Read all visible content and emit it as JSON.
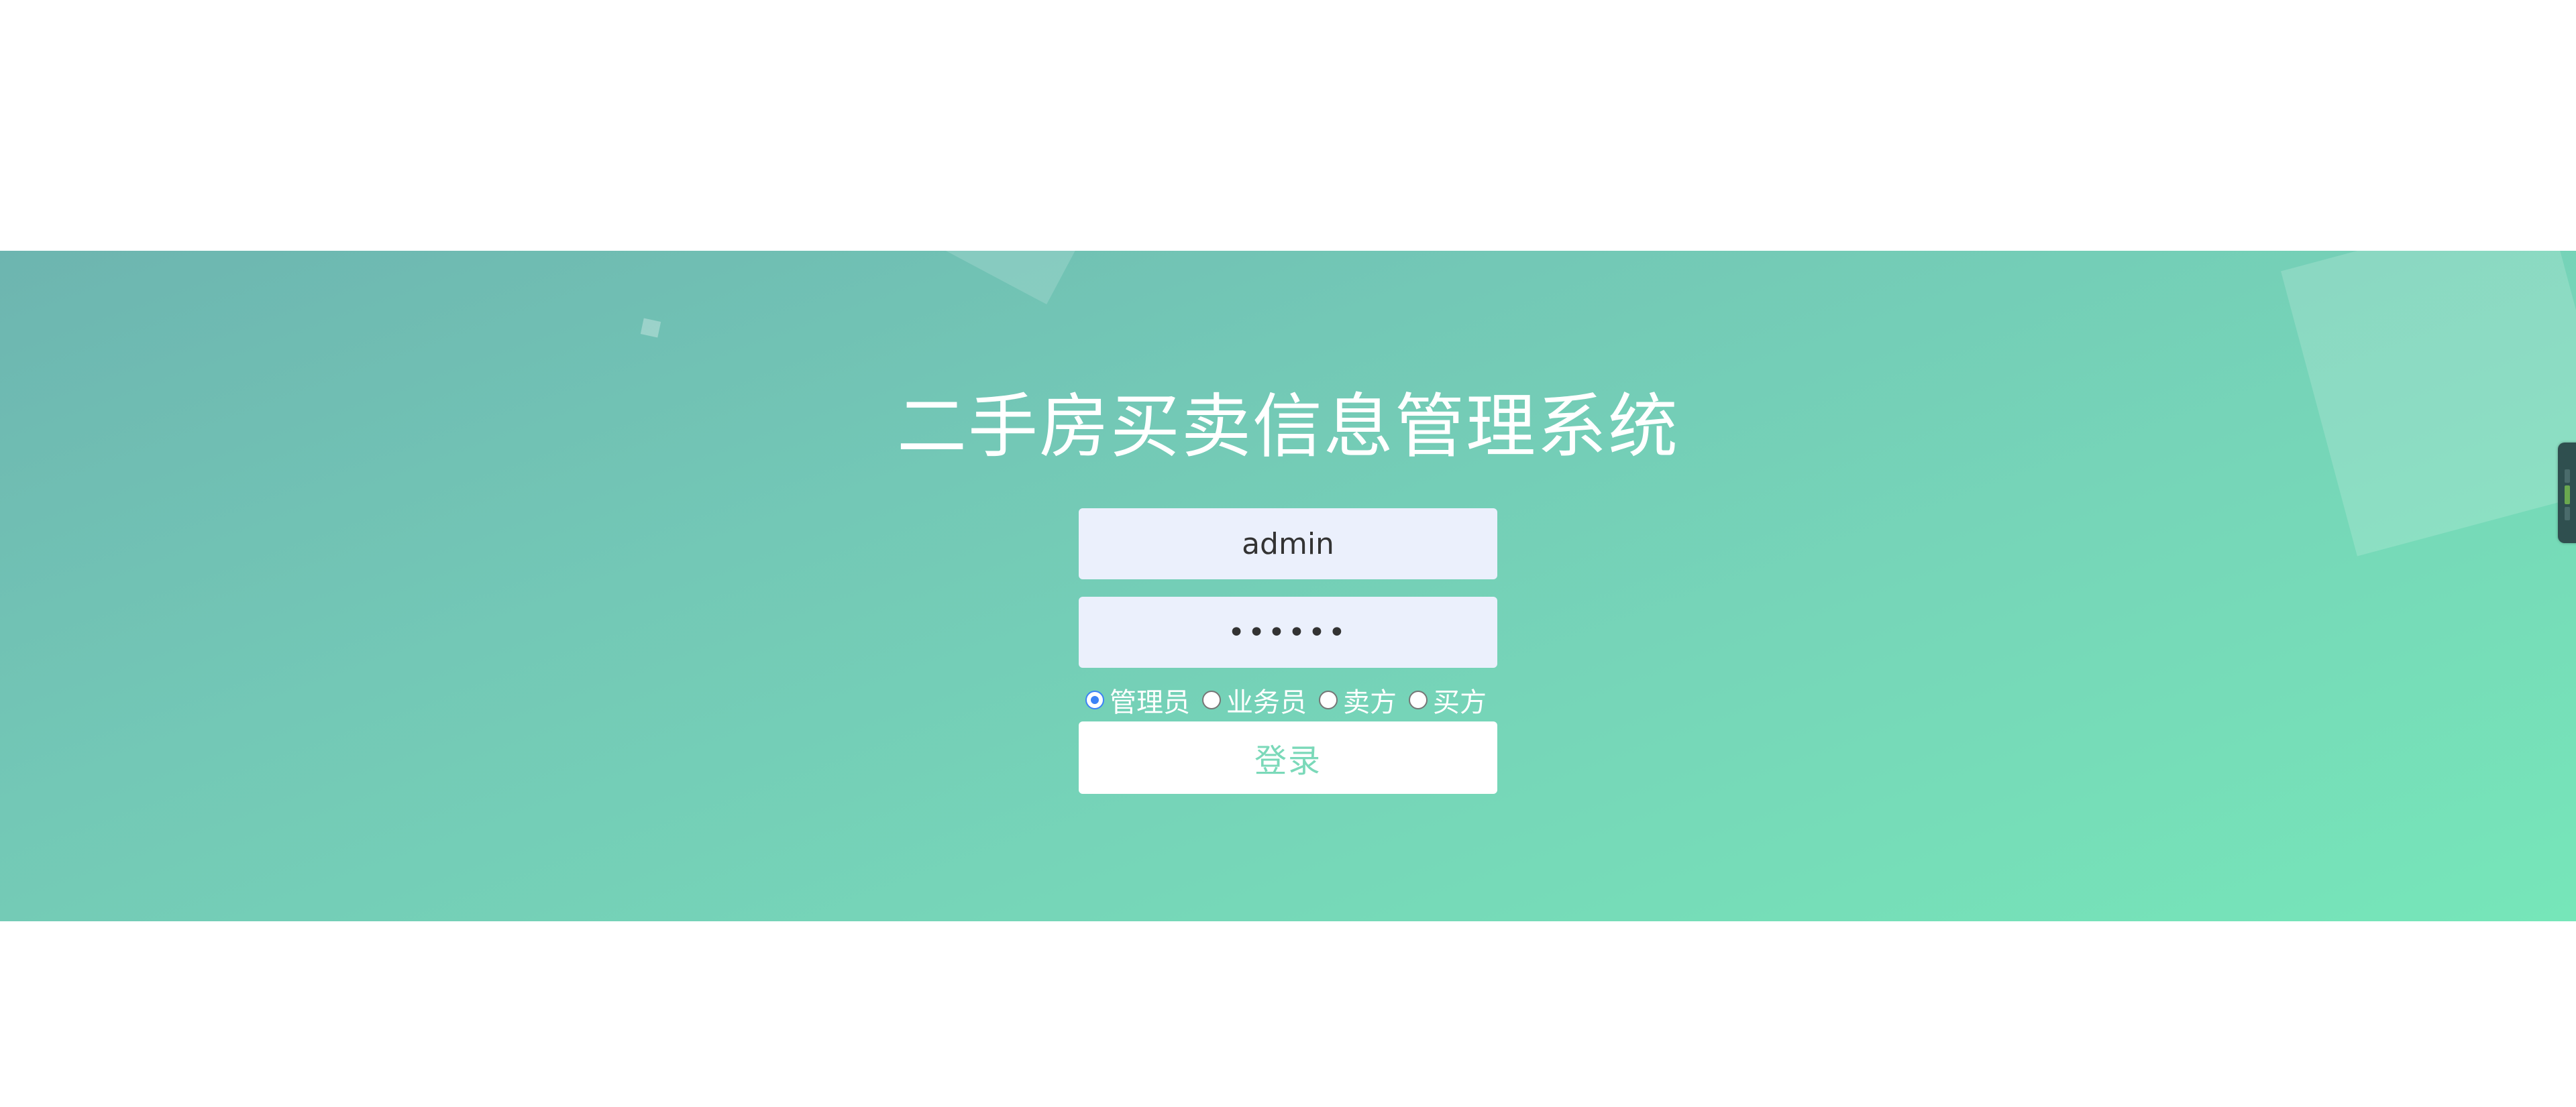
{
  "app": {
    "title": "二手房买卖信息管理系统"
  },
  "login": {
    "username_value": "admin",
    "password_display": "••••••",
    "roles": [
      {
        "label": "管理员",
        "checked": true
      },
      {
        "label": "业务员",
        "checked": false
      },
      {
        "label": "卖方",
        "checked": false
      },
      {
        "label": "买方",
        "checked": false
      }
    ],
    "submit_label": "登录"
  },
  "colors": {
    "gradient_start": "#6db5b0",
    "gradient_end": "#76e6b9",
    "input_bg": "#ebf0fc",
    "button_text": "#7bd9b9",
    "radio_checked": "#3b82f6"
  }
}
